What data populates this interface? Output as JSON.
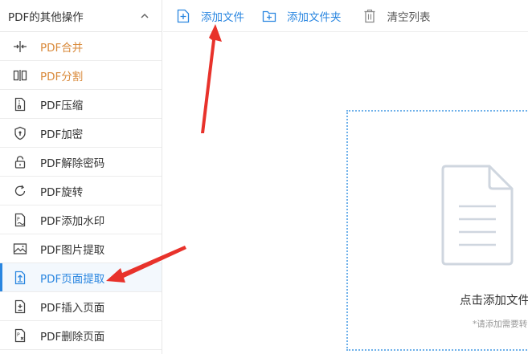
{
  "sidebar": {
    "title": "PDF的其他操作",
    "items": [
      {
        "label": "PDF合并",
        "icon": "merge-icon"
      },
      {
        "label": "PDF分割",
        "icon": "split-icon"
      },
      {
        "label": "PDF压缩",
        "icon": "compress-icon"
      },
      {
        "label": "PDF加密",
        "icon": "shield-icon"
      },
      {
        "label": "PDF解除密码",
        "icon": "lock-icon"
      },
      {
        "label": "PDF旋转",
        "icon": "rotate-icon"
      },
      {
        "label": "PDF添加水印",
        "icon": "watermark-icon"
      },
      {
        "label": "PDF图片提取",
        "icon": "image-icon"
      },
      {
        "label": "PDF页面提取",
        "icon": "page-extract-icon",
        "active": true
      },
      {
        "label": "PDF插入页面",
        "icon": "page-insert-icon"
      },
      {
        "label": "PDF删除页面",
        "icon": "page-delete-icon"
      }
    ]
  },
  "toolbar": {
    "add_file": "添加文件",
    "add_folder": "添加文件夹",
    "clear_list": "清空列表"
  },
  "dropzone": {
    "title": "点击添加文件",
    "subtitle": "*请添加需要转"
  },
  "colors": {
    "accent": "#2a86e0",
    "highlight": "#d9893a",
    "arrow": "#e8322b"
  }
}
